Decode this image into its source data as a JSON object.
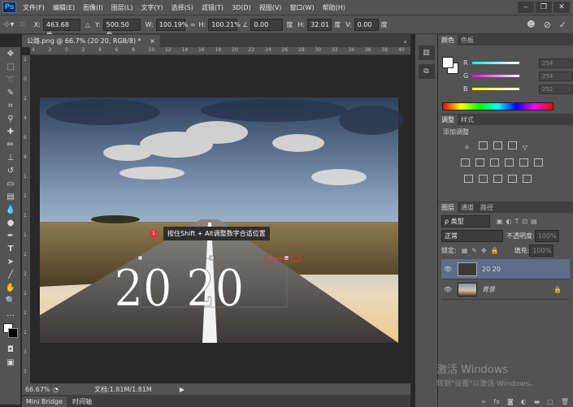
{
  "app": {
    "logo": "Ps"
  },
  "menu": [
    "文件(F)",
    "编辑(E)",
    "图像(I)",
    "图层(L)",
    "文字(Y)",
    "选择(S)",
    "滤镜(T)",
    "3D(D)",
    "视图(V)",
    "窗口(W)",
    "帮助(H)"
  ],
  "window_buttons": [
    "‒",
    "❐",
    "✕"
  ],
  "options": {
    "x_label": "X:",
    "x_value": "463.68 像",
    "y_label": "Y:",
    "y_value": "500.50 像",
    "w_label": "W:",
    "w_value": "100.19%",
    "h_label": "H:",
    "h_value": "100.21%",
    "angle_value": "0.00",
    "angle_unit": "度",
    "hskew_label": "H:",
    "hskew_value": "32.01",
    "hskew_unit": "度",
    "vskew_label": "V:",
    "vskew_value": "0.00",
    "vskew_unit": "度"
  },
  "document": {
    "tab_title": "公路.png @ 66.7% (20 20, RGB/8) *",
    "zoom": "66.67%",
    "doc_info": "文档:1.81M/1.81M",
    "canvas_text": "20 20",
    "annotation": {
      "number": "1",
      "text": "按住Shift + Alt调整数字合适位置"
    }
  },
  "ruler_h": [
    "4",
    "2",
    "0",
    "2",
    "4",
    "6",
    "8",
    "10",
    "12",
    "14",
    "16",
    "18",
    "20",
    "22",
    "24",
    "26",
    "28",
    "30",
    "32",
    "34",
    "36",
    "38",
    "40"
  ],
  "ruler_v": [
    "2",
    "0",
    "2",
    "4",
    "6",
    "8",
    "1",
    "1",
    "1",
    "1",
    "2",
    "2",
    "2",
    "2",
    "2",
    "3",
    "3"
  ],
  "bottom_tabs": [
    "Mini Bridge",
    "时间轴"
  ],
  "color_panel": {
    "tabs": [
      "颜色",
      "色板"
    ],
    "r_label": "R",
    "r_value": "254",
    "g_label": "G",
    "g_value": "254",
    "b_label": "B",
    "b_value": "252"
  },
  "adjust_panel": {
    "tabs": [
      "调整",
      "样式"
    ],
    "title": "添加调整"
  },
  "layers_panel": {
    "tabs": [
      "图层",
      "通道",
      "路径"
    ],
    "filter_kind": "ρ 类型",
    "blend_mode": "正常",
    "opacity_label": "不透明度:",
    "opacity_value": "100%",
    "lock_label": "锁定:",
    "fill_label": "填充:",
    "fill_value": "100%",
    "layers": [
      {
        "name": "20 20",
        "selected": true
      },
      {
        "name": "背景",
        "selected": false
      }
    ]
  },
  "watermark": {
    "line1": "激活 Windows",
    "line2": "转到\"设置\"以激活 Windows。"
  },
  "colors": {
    "accent": "#e0303a",
    "panel": "#535353",
    "dark": "#282828"
  }
}
